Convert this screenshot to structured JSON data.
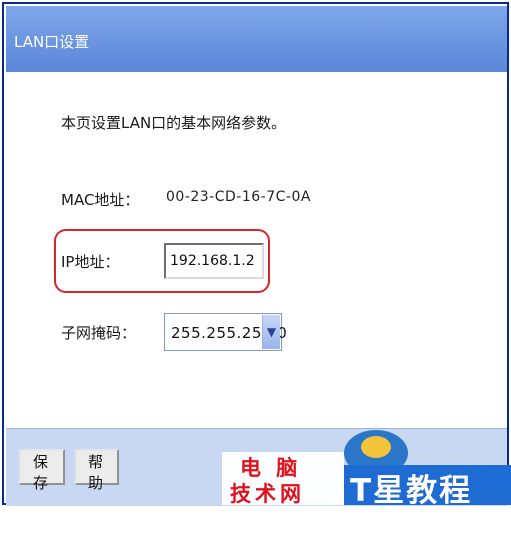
{
  "window": {
    "title": "LAN口设置"
  },
  "main": {
    "description": "本页设置LAN口的基本网络参数。",
    "mac": {
      "label": "MAC地址：",
      "value": "00-23-CD-16-7C-0A"
    },
    "ip": {
      "label": "IP地址：",
      "value": "192.168.1.2"
    },
    "subnet": {
      "label": "子网掩码：",
      "value": "255.255.255.0"
    }
  },
  "footer": {
    "save_label": "保 存",
    "help_label": "帮 助"
  },
  "watermark": {
    "line1": "电 脑",
    "line2": "技术网",
    "brand": "T星教程网"
  },
  "colors": {
    "titlebar": "#6e98e2",
    "footer": "#c9d8f2",
    "highlight": "#d8242c",
    "border": "#0a2a8a"
  },
  "icons": {
    "dropdown": "chevron-down-icon"
  }
}
